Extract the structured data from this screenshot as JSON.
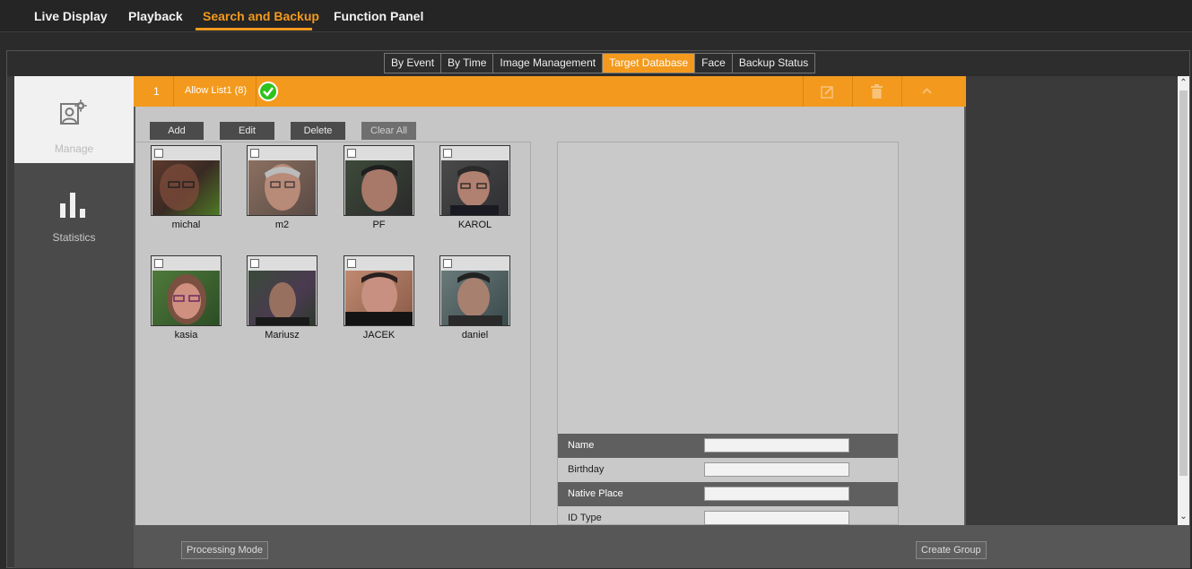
{
  "top_nav": {
    "items": [
      {
        "label": "Live Display",
        "active": false
      },
      {
        "label": "Playback",
        "active": false
      },
      {
        "label": "Search and Backup",
        "active": true
      },
      {
        "label": "Function Panel",
        "active": false
      }
    ]
  },
  "sub_tabs": [
    {
      "label": "By Event",
      "active": false
    },
    {
      "label": "By Time",
      "active": false
    },
    {
      "label": "Image Management",
      "active": false
    },
    {
      "label": "Target Database",
      "active": true
    },
    {
      "label": "Face",
      "active": false
    },
    {
      "label": "Backup Status",
      "active": false
    }
  ],
  "left_nav": {
    "items": [
      {
        "label": "Manage",
        "icon": "manage-person-gear-icon",
        "active": true
      },
      {
        "label": "Statistics",
        "icon": "bar-chart-icon",
        "active": false
      }
    ]
  },
  "group": {
    "number": "1",
    "name": "Allow List1 (8)",
    "status_icon": "check-circle-icon",
    "actions": [
      "edit-icon",
      "trash-icon",
      "chevron-up-icon"
    ]
  },
  "toolbar": {
    "add": "Add",
    "edit": "Edit",
    "delete": "Delete",
    "clear_all": "Clear All"
  },
  "faces": [
    {
      "name": "michal",
      "checked": false
    },
    {
      "name": "m2",
      "checked": false
    },
    {
      "name": "PF",
      "checked": false
    },
    {
      "name": "KAROL",
      "checked": false
    },
    {
      "name": "kasia",
      "checked": false
    },
    {
      "name": "Mariusz",
      "checked": false
    },
    {
      "name": "JACEK",
      "checked": false
    },
    {
      "name": "daniel",
      "checked": false
    }
  ],
  "details": {
    "fields": [
      {
        "label": "Name",
        "value": ""
      },
      {
        "label": "Birthday",
        "value": ""
      },
      {
        "label": "Native Place",
        "value": ""
      },
      {
        "label": "ID Type",
        "value": ""
      }
    ]
  },
  "footer": {
    "processing_mode": "Processing Mode",
    "create_group": "Create Group"
  },
  "colors": {
    "accent": "#f39a1e",
    "success": "#2ec21d"
  }
}
